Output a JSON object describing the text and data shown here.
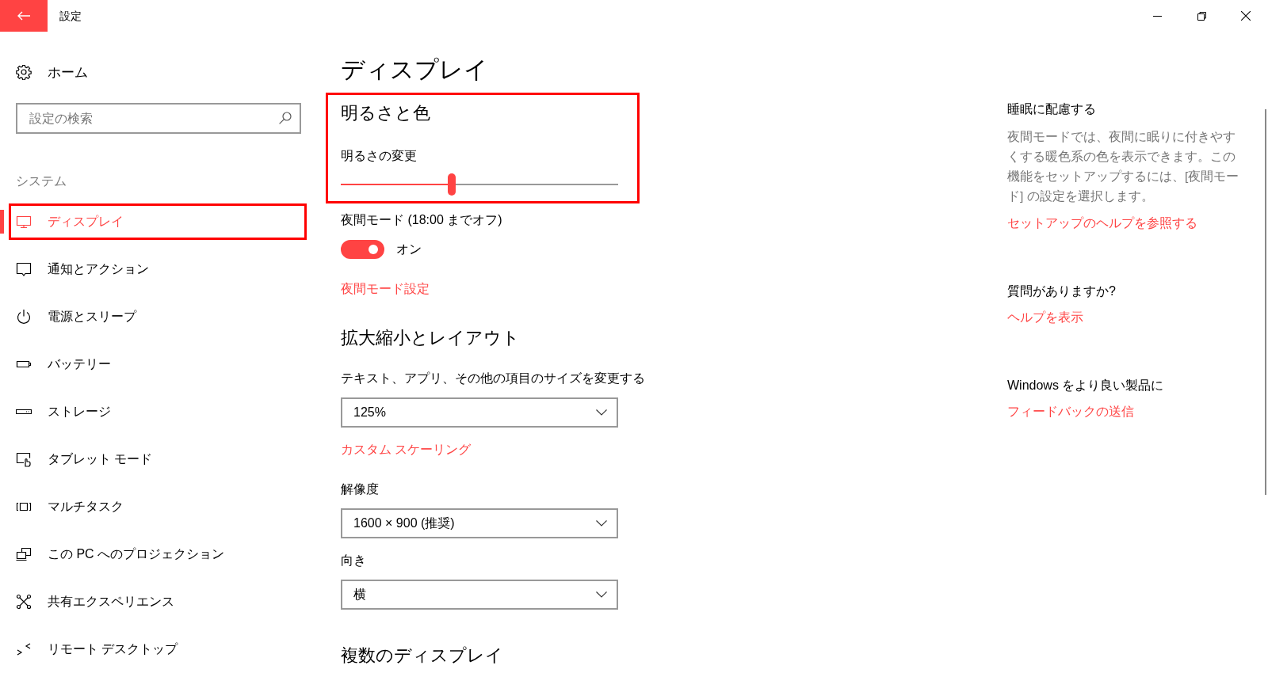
{
  "window": {
    "title": "設定"
  },
  "sidebar": {
    "home": "ホーム",
    "search": {
      "placeholder": "設定の検索"
    },
    "section": "システム",
    "items": [
      {
        "label": "ディスプレイ",
        "selected": true,
        "highlighted": true
      },
      {
        "label": "通知とアクション",
        "selected": false,
        "highlighted": false
      },
      {
        "label": "電源とスリープ",
        "selected": false,
        "highlighted": false
      },
      {
        "label": "バッテリー",
        "selected": false,
        "highlighted": false
      },
      {
        "label": "ストレージ",
        "selected": false,
        "highlighted": false
      },
      {
        "label": "タブレット モード",
        "selected": false,
        "highlighted": false
      },
      {
        "label": "マルチタスク",
        "selected": false,
        "highlighted": false
      },
      {
        "label": "この PC へのプロジェクション",
        "selected": false,
        "highlighted": false
      },
      {
        "label": "共有エクスペリエンス",
        "selected": false,
        "highlighted": false
      },
      {
        "label": "リモート デスクトップ",
        "selected": false,
        "highlighted": false
      }
    ]
  },
  "main": {
    "title": "ディスプレイ",
    "brightness": {
      "highlighted": true,
      "heading": "明るさと色",
      "label": "明るさの変更",
      "level": 0.4
    },
    "night_light": {
      "label": "夜間モード (18:00 までオフ)",
      "on": true,
      "state_text": "オン",
      "link": "夜間モード設定"
    },
    "scale_layout": {
      "heading": "拡大縮小とレイアウト",
      "settings": [
        {
          "label": "テキスト、アプリ、その他の項目のサイズを変更する",
          "value": "125%",
          "link": "カスタム スケーリング"
        },
        {
          "label": "解像度",
          "value": "1600 × 900 (推奨)"
        },
        {
          "label": "向き",
          "value": "横"
        }
      ]
    },
    "multiple_displays": {
      "heading": "複数のディスプレイ"
    }
  },
  "related": [
    {
      "heading": "睡眠に配慮する",
      "text": "夜間モードでは、夜間に眠りに付きやすくする暖色系の色を表示できます。この機能をセットアップするには、[夜間モード] の設定を選択します。",
      "link": "セットアップのヘルプを参照する"
    },
    {
      "heading": "質問がありますか?",
      "link": "ヘルプを表示"
    },
    {
      "heading": "Windows をより良い製品に",
      "link": "フィードバックの送信"
    }
  ]
}
